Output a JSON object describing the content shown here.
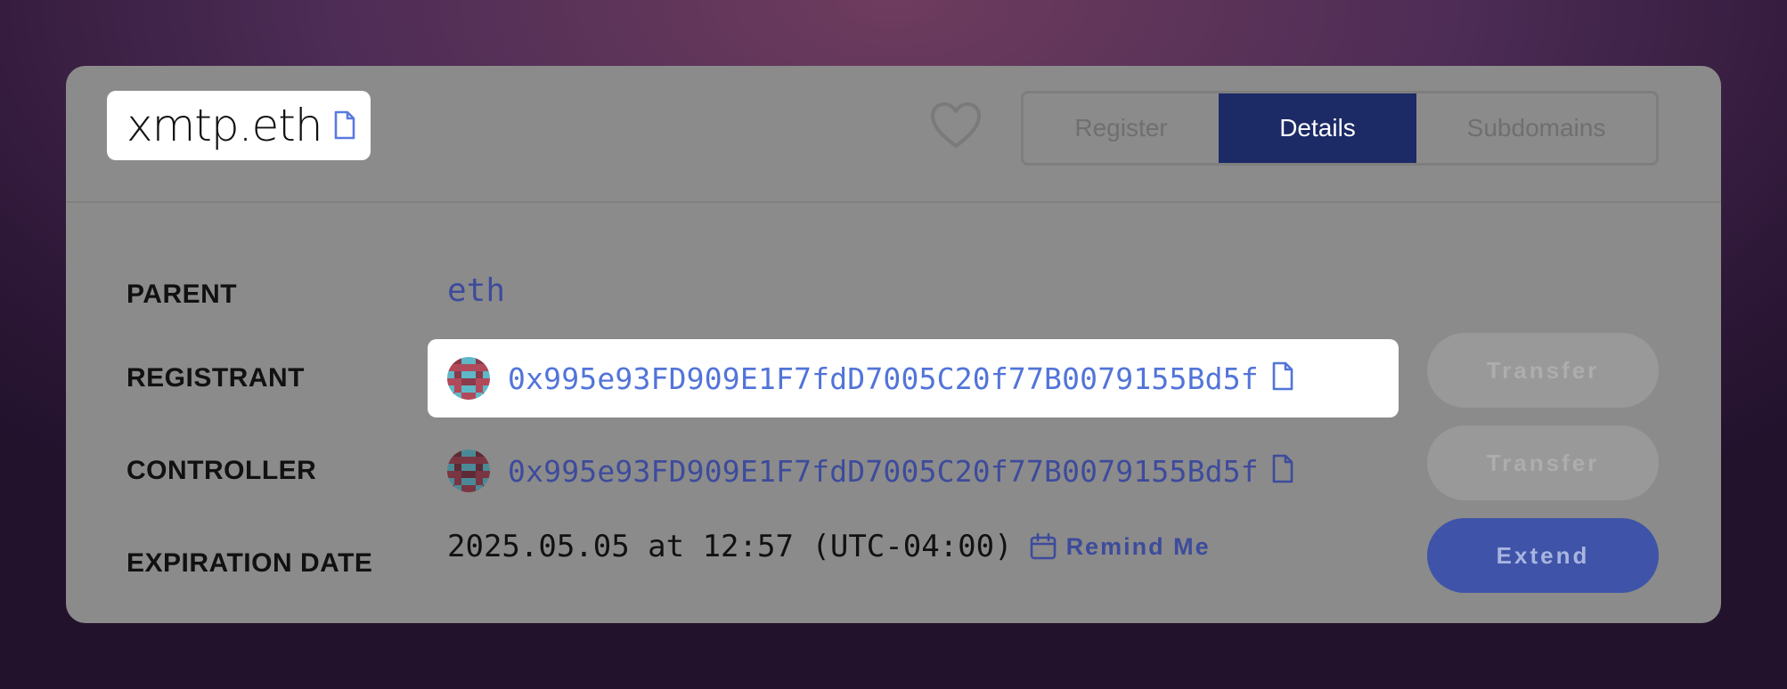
{
  "header": {
    "domain_name": "xmtp.eth",
    "tabs": [
      {
        "label": "Register"
      },
      {
        "label": "Details"
      },
      {
        "label": "Subdomains"
      }
    ]
  },
  "details": {
    "parent": {
      "label": "PARENT",
      "value": "eth"
    },
    "registrant": {
      "label": "REGISTRANT",
      "address": "0x995e93FD909E1F7fdD7005C20f77B0079155Bd5f",
      "action": "Transfer"
    },
    "controller": {
      "label": "CONTROLLER",
      "address": "0x995e93FD909E1F7fdD7005C20f77B0079155Bd5f",
      "action": "Transfer"
    },
    "expiration": {
      "label": "EXPIRATION DATE",
      "value": "2025.05.05 at 12:57 (UTC-04:00)",
      "remind_label": "Remind Me",
      "action": "Extend"
    }
  },
  "colors": {
    "active_tab": "#1c2a66",
    "link": "#3d4b9c",
    "highlight_link": "#5274d9",
    "extend_button": "#3f54a8"
  },
  "icons": [
    "copy-icon",
    "heart-icon",
    "calendar-icon",
    "avatar"
  ]
}
